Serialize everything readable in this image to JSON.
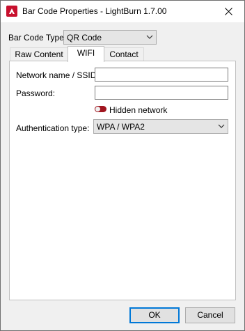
{
  "window": {
    "title": "Bar Code Properties - LightBurn 1.7.00",
    "app_icon": "lightburn-logo-icon",
    "close_icon": "close-icon"
  },
  "barcode_type": {
    "label": "Bar Code Type",
    "value": "QR Code"
  },
  "tabs": [
    {
      "label": "Raw Content",
      "active": false
    },
    {
      "label": "WIFI",
      "active": true
    },
    {
      "label": "Contact",
      "active": false
    }
  ],
  "wifi": {
    "ssid_label": "Network name / SSID:",
    "ssid_value": "",
    "password_label": "Password:",
    "password_value": "",
    "hidden_label": "Hidden network",
    "hidden_toggle_color": "#a0151f",
    "auth_label": "Authentication type:",
    "auth_value": "WPA / WPA2"
  },
  "buttons": {
    "ok": "OK",
    "cancel": "Cancel"
  }
}
